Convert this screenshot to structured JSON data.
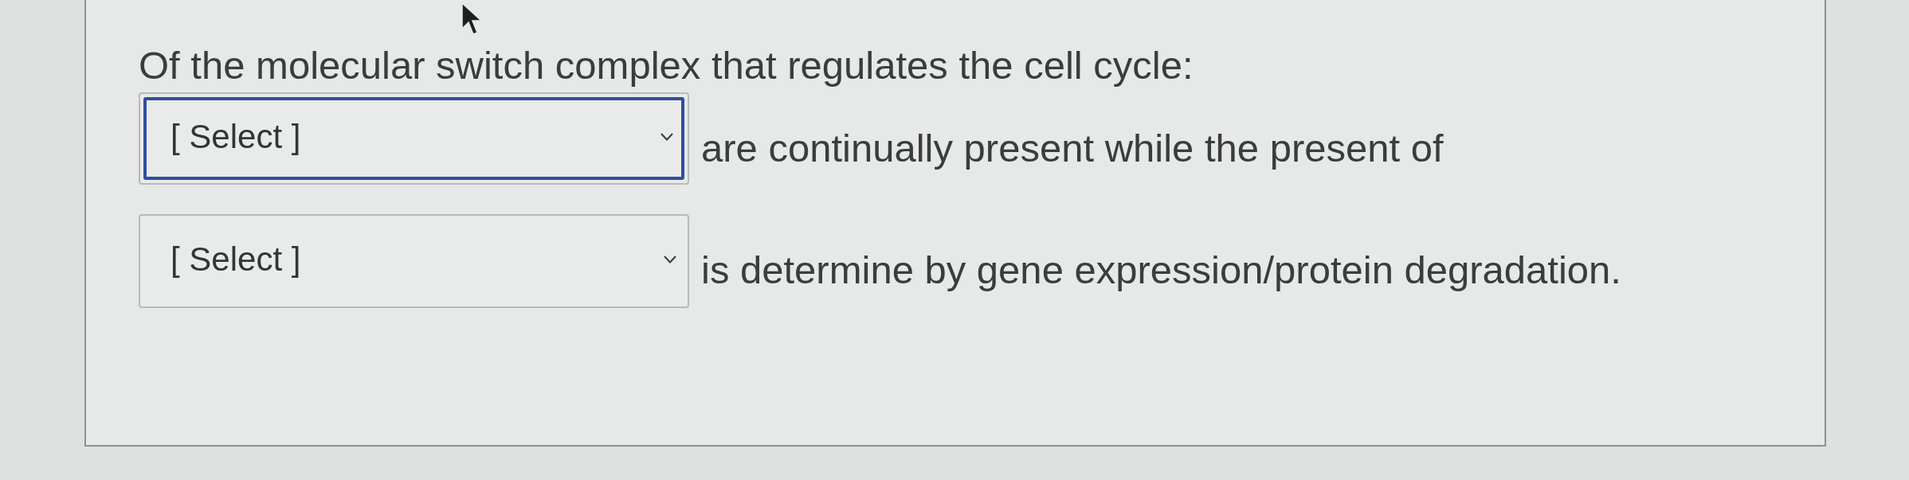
{
  "question": {
    "prompt": "Of the molecular switch complex that regulates the cell cycle:"
  },
  "rows": [
    {
      "dropdown": {
        "value": "[ Select ]",
        "focused": true
      },
      "text": "are continually present while the present of"
    },
    {
      "dropdown": {
        "value": "[ Select ]",
        "focused": false
      },
      "text": "is determine by gene expression/protein degradation."
    }
  ]
}
